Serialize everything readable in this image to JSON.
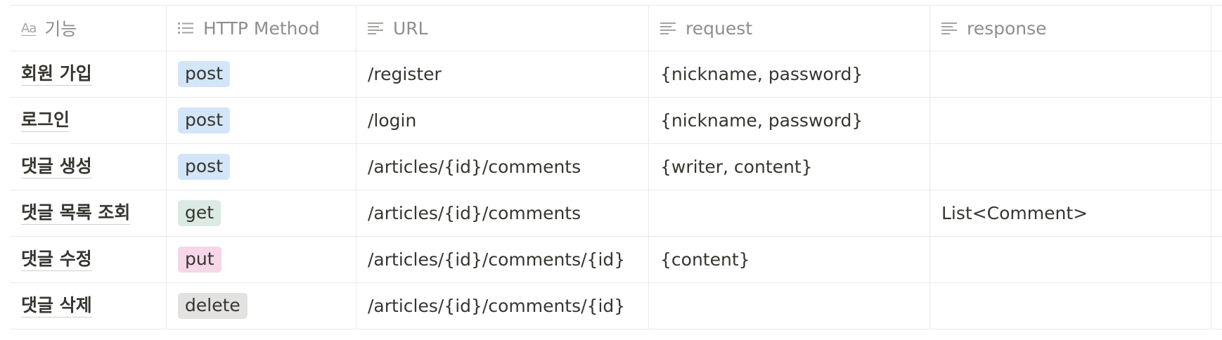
{
  "columns": [
    {
      "label": "기능",
      "icon": "title-aa-icon"
    },
    {
      "label": "HTTP Method",
      "icon": "list-icon"
    },
    {
      "label": "URL",
      "icon": "text-lines-icon"
    },
    {
      "label": "request",
      "icon": "text-lines-icon"
    },
    {
      "label": "response",
      "icon": "text-lines-icon"
    }
  ],
  "aa_glyph": "Aa",
  "tag_colors": {
    "post": "#d3e5f8",
    "get": "#dbeae3",
    "put": "#f5d7e8",
    "delete": "#e3e2e0"
  },
  "rows": [
    {
      "name": "회원 가입",
      "method": "post",
      "url": "/register",
      "request": "{nickname, password}",
      "response": ""
    },
    {
      "name": "로그인",
      "method": "post",
      "url": "/login",
      "request": "{nickname, password}",
      "response": ""
    },
    {
      "name": "댓글 생성",
      "method": "post",
      "url": "/articles/{id}/comments",
      "request": "{writer, content}",
      "response": ""
    },
    {
      "name": "댓글 목록 조회",
      "method": "get",
      "url": "/articles/{id}/comments",
      "request": "",
      "response": "List<Comment>"
    },
    {
      "name": "댓글 수정",
      "method": "put",
      "url": "/articles/{id}/comments/{id}",
      "request": "{content}",
      "response": ""
    },
    {
      "name": "댓글 삭제",
      "method": "delete",
      "url": "/articles/{id}/comments/{id}",
      "request": "",
      "response": ""
    }
  ]
}
